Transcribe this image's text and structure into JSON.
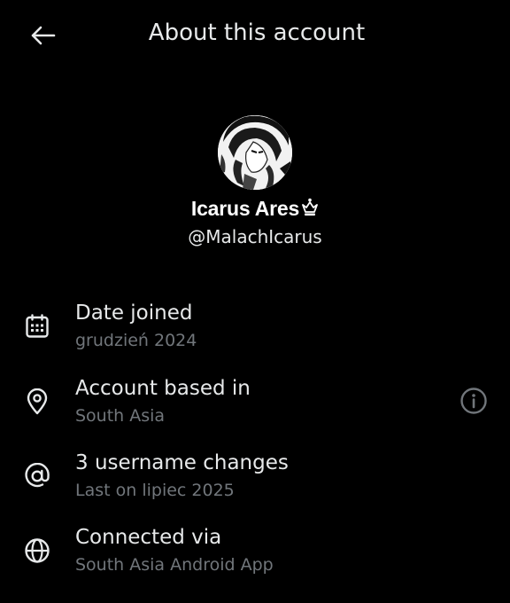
{
  "header": {
    "title": "About this account",
    "back_icon": "arrow-left-icon"
  },
  "profile": {
    "display_name": "Icarus Ares",
    "badge_icon": "crown-icon",
    "handle": "@MalachIcarus"
  },
  "rows": [
    {
      "icon": "calendar-icon",
      "title": "Date joined",
      "subtitle": "grudzień 2024"
    },
    {
      "icon": "location-pin-icon",
      "title": "Account based in",
      "subtitle": "South Asia",
      "action_icon": "info-icon"
    },
    {
      "icon": "at-sign-icon",
      "title": "3 username changes",
      "subtitle": "Last on lipiec 2025"
    },
    {
      "icon": "globe-icon",
      "title": "Connected via",
      "subtitle": "South Asia Android App"
    }
  ],
  "colors": {
    "background": "#000000",
    "primary_text": "#e7e9ea",
    "secondary_text": "#71767b"
  }
}
